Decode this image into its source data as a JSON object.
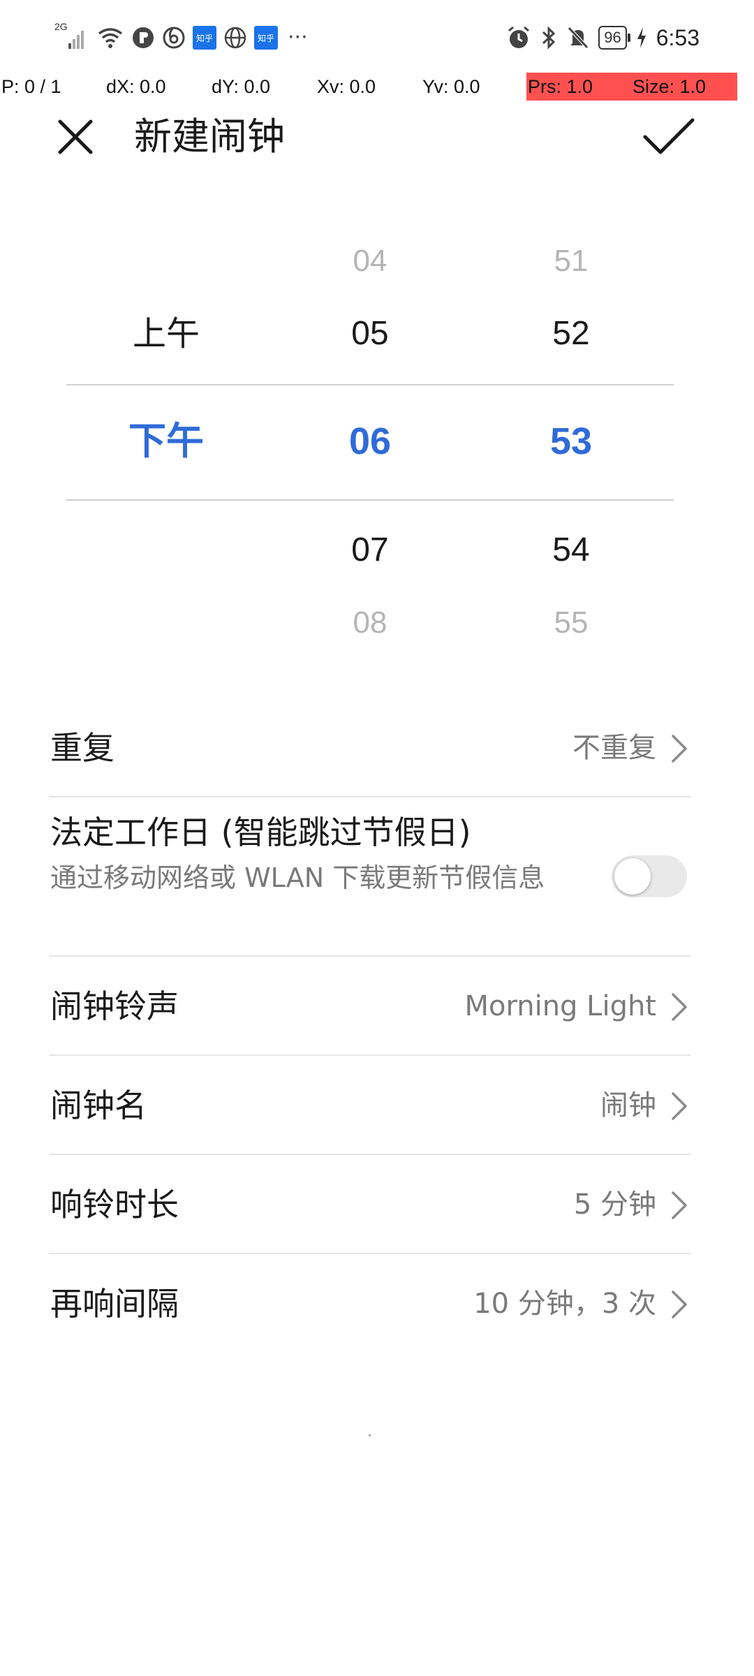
{
  "status_bar": {
    "network_label": "2G",
    "zhihu_badge_1": "知乎",
    "zhihu_badge_2": "知乎",
    "more": "···",
    "battery": "96",
    "time": "6:53"
  },
  "debug": {
    "pointers": "P: 0 / 1",
    "dx": "dX: 0.0",
    "dy": "dY: 0.0",
    "xv": "Xv: 0.0",
    "yv": "Yv: 0.0",
    "prs": "Prs: 1.0",
    "size": "Size: 1.0",
    "highlight_color": "#ff5050"
  },
  "header": {
    "title": "新建闹钟",
    "close_icon": "close-icon",
    "confirm_icon": "check-icon"
  },
  "picker": {
    "period": {
      "above": "上午",
      "selected": "下午"
    },
    "hour": {
      "above2": "04",
      "above1": "05",
      "selected": "06",
      "below1": "07",
      "below2": "08"
    },
    "minute": {
      "above2": "51",
      "above1": "52",
      "selected": "53",
      "below1": "54",
      "below2": "55"
    },
    "accent_color": "#2f6bd8"
  },
  "settings": {
    "repeat": {
      "label": "重复",
      "value": "不重复"
    },
    "workday": {
      "label": "法定工作日 (智能跳过节假日)",
      "sub": "通过移动网络或 WLAN 下载更新节假信息",
      "enabled": false
    },
    "ringtone": {
      "label": "闹钟铃声",
      "value": "Morning Light"
    },
    "name": {
      "label": "闹钟名",
      "value": "闹钟"
    },
    "duration": {
      "label": "响铃时长",
      "value": "5 分钟"
    },
    "snooze": {
      "label": "再响间隔",
      "value": "10 分钟，3 次"
    }
  }
}
